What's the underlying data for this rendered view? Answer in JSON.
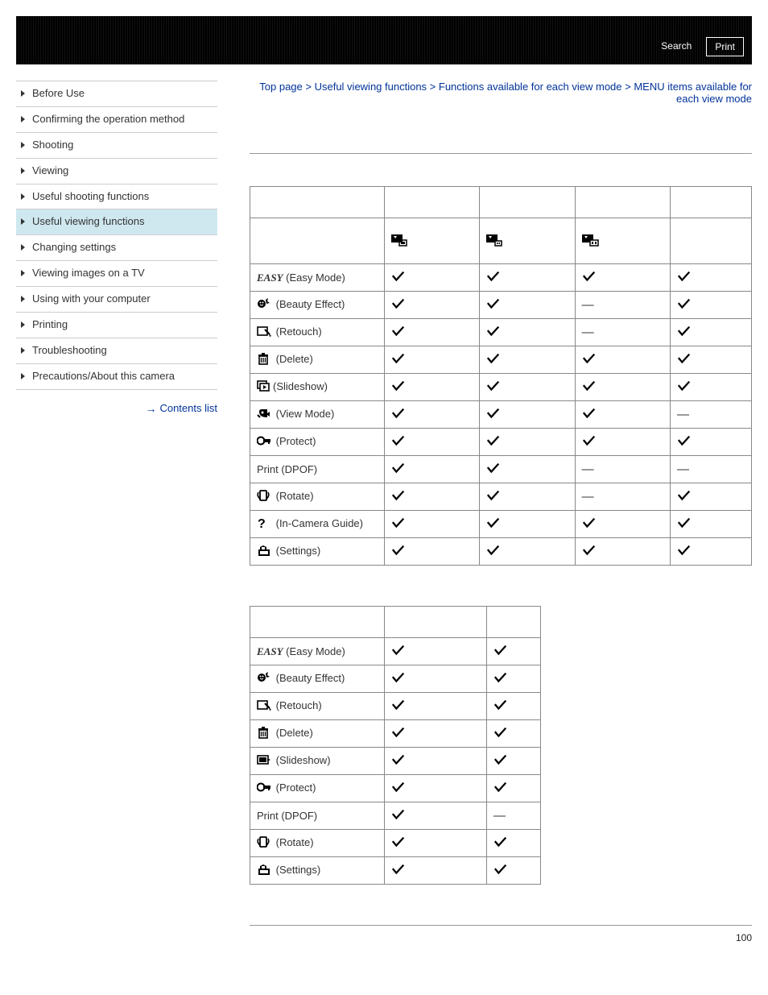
{
  "header": {
    "search_label": "Search",
    "print_label": "Print"
  },
  "sidebar": {
    "items": [
      {
        "label": "Before Use"
      },
      {
        "label": "Confirming the operation method"
      },
      {
        "label": "Shooting"
      },
      {
        "label": "Viewing"
      },
      {
        "label": "Useful shooting functions"
      },
      {
        "label": "Useful viewing functions"
      },
      {
        "label": "Changing settings"
      },
      {
        "label": "Viewing images on a TV"
      },
      {
        "label": "Using with your computer"
      },
      {
        "label": "Printing"
      },
      {
        "label": "Troubleshooting"
      },
      {
        "label": "Precautions/About this camera"
      }
    ],
    "contents_list_label": "Contents list"
  },
  "breadcrumb": {
    "top": "Top page",
    "sep": " > ",
    "l1": "Useful viewing functions",
    "l2": "Functions available for each view mode",
    "current": "MENU items available for each view mode"
  },
  "table1": {
    "rows": [
      {
        "icon": "easy",
        "label": " (Easy Mode)",
        "easy_text": "EASY",
        "v": [
          "check",
          "check",
          "check",
          "check"
        ]
      },
      {
        "icon": "beauty",
        "label": " (Beauty Effect)",
        "v": [
          "check",
          "check",
          "dash",
          "check"
        ]
      },
      {
        "icon": "retouch",
        "label": " (Retouch)",
        "v": [
          "check",
          "check",
          "dash",
          "check"
        ]
      },
      {
        "icon": "delete",
        "label": " (Delete)",
        "v": [
          "check",
          "check",
          "check",
          "check"
        ]
      },
      {
        "icon": "slideshow",
        "label": "(Slideshow)",
        "v": [
          "check",
          "check",
          "check",
          "check"
        ]
      },
      {
        "icon": "viewmode",
        "label": " (View Mode)",
        "v": [
          "check",
          "check",
          "check",
          "dash"
        ]
      },
      {
        "icon": "protect",
        "label": " (Protect)",
        "v": [
          "check",
          "check",
          "check",
          "check"
        ]
      },
      {
        "icon": "none",
        "label": "Print (DPOF)",
        "v": [
          "check",
          "check",
          "dash",
          "dash"
        ]
      },
      {
        "icon": "rotate",
        "label": " (Rotate)",
        "v": [
          "check",
          "check",
          "dash",
          "check"
        ]
      },
      {
        "icon": "guide",
        "label": " (In-Camera Guide)",
        "v": [
          "check",
          "check",
          "check",
          "check"
        ]
      },
      {
        "icon": "settings",
        "label": " (Settings)",
        "v": [
          "check",
          "check",
          "check",
          "check"
        ]
      }
    ]
  },
  "table2": {
    "rows": [
      {
        "icon": "easy",
        "label": " (Easy Mode)",
        "easy_text": "EASY",
        "v": [
          "check",
          "check"
        ]
      },
      {
        "icon": "beauty",
        "label": " (Beauty Effect)",
        "v": [
          "check",
          "check"
        ]
      },
      {
        "icon": "retouch",
        "label": " (Retouch)",
        "v": [
          "check",
          "check"
        ]
      },
      {
        "icon": "delete",
        "label": " (Delete)",
        "v": [
          "check",
          "check"
        ]
      },
      {
        "icon": "slideshow2",
        "label": " (Slideshow)",
        "v": [
          "check",
          "check"
        ]
      },
      {
        "icon": "protect",
        "label": " (Protect)",
        "v": [
          "check",
          "check"
        ]
      },
      {
        "icon": "none",
        "label": "Print (DPOF)",
        "v": [
          "check",
          "dash"
        ]
      },
      {
        "icon": "rotate",
        "label": " (Rotate)",
        "v": [
          "check",
          "check"
        ]
      },
      {
        "icon": "settings",
        "label": " (Settings)",
        "v": [
          "check",
          "check"
        ]
      }
    ]
  },
  "page_number": "100"
}
